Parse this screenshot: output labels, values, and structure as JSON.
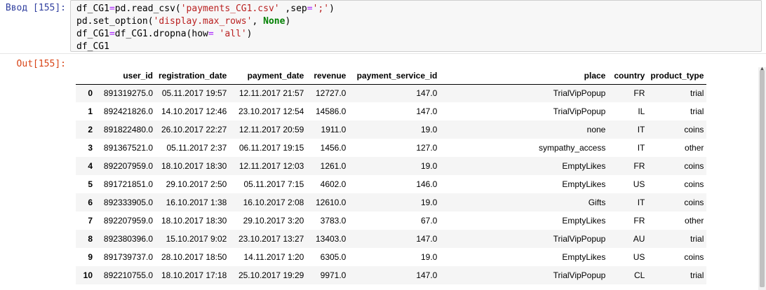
{
  "input": {
    "prompt": "Ввод [155]:",
    "code": [
      [
        {
          "t": "df_CG1",
          "c": ""
        },
        {
          "t": "=",
          "c": "o"
        },
        {
          "t": "pd.read_csv(",
          "c": ""
        },
        {
          "t": "'payments_CG1.csv'",
          "c": "s"
        },
        {
          "t": " ,sep",
          "c": ""
        },
        {
          "t": "=",
          "c": "o"
        },
        {
          "t": "';'",
          "c": "s"
        },
        {
          "t": ")",
          "c": ""
        }
      ],
      [
        {
          "t": "pd.set_option(",
          "c": ""
        },
        {
          "t": "'display.max_rows'",
          "c": "s"
        },
        {
          "t": ", ",
          "c": ""
        },
        {
          "t": "None",
          "c": "k"
        },
        {
          "t": ")",
          "c": ""
        }
      ],
      [
        {
          "t": "df_CG1",
          "c": ""
        },
        {
          "t": "=",
          "c": "o"
        },
        {
          "t": "df_CG1.dropna(how",
          "c": ""
        },
        {
          "t": "=",
          "c": "o"
        },
        {
          "t": " ",
          "c": ""
        },
        {
          "t": "'all'",
          "c": "s"
        },
        {
          "t": ")",
          "c": ""
        }
      ],
      [
        {
          "t": "df_CG1",
          "c": ""
        }
      ]
    ]
  },
  "output": {
    "prompt": "Out[155]:",
    "columns": [
      "",
      "user_id",
      "registration_date",
      "payment_date",
      "revenue",
      "payment_service_id",
      "place",
      "country",
      "product_type"
    ],
    "rows": [
      [
        "0",
        "891319275.0",
        "05.11.2017 19:57",
        "12.11.2017 21:57",
        "12727.0",
        "147.0",
        "TrialVipPopup",
        "FR",
        "trial"
      ],
      [
        "1",
        "892421826.0",
        "14.10.2017 12:46",
        "23.10.2017 12:54",
        "14586.0",
        "147.0",
        "TrialVipPopup",
        "IL",
        "trial"
      ],
      [
        "2",
        "891822480.0",
        "26.10.2017 22:27",
        "12.11.2017 20:59",
        "1911.0",
        "19.0",
        "none",
        "IT",
        "coins"
      ],
      [
        "3",
        "891367521.0",
        "05.11.2017 2:37",
        "06.11.2017 19:15",
        "1456.0",
        "127.0",
        "sympathy_access",
        "IT",
        "other"
      ],
      [
        "4",
        "892207959.0",
        "18.10.2017 18:30",
        "12.11.2017 12:03",
        "1261.0",
        "19.0",
        "EmptyLikes",
        "FR",
        "coins"
      ],
      [
        "5",
        "891721851.0",
        "29.10.2017 2:50",
        "05.11.2017 7:15",
        "4602.0",
        "146.0",
        "EmptyLikes",
        "US",
        "coins"
      ],
      [
        "6",
        "892333905.0",
        "16.10.2017 1:38",
        "16.10.2017 2:08",
        "12610.0",
        "19.0",
        "Gifts",
        "IT",
        "coins"
      ],
      [
        "7",
        "892207959.0",
        "18.10.2017 18:30",
        "29.10.2017 3:20",
        "3783.0",
        "67.0",
        "EmptyLikes",
        "FR",
        "other"
      ],
      [
        "8",
        "892380396.0",
        "15.10.2017 9:02",
        "23.10.2017 13:27",
        "13403.0",
        "147.0",
        "TrialVipPopup",
        "AU",
        "trial"
      ],
      [
        "9",
        "891739737.0",
        "28.10.2017 18:50",
        "14.11.2017 1:20",
        "6305.0",
        "19.0",
        "EmptyLikes",
        "US",
        "coins"
      ],
      [
        "10",
        "892210755.0",
        "18.10.2017 17:18",
        "25.10.2017 19:29",
        "9971.0",
        "147.0",
        "TrialVipPopup",
        "CL",
        "trial"
      ]
    ]
  },
  "colors": {
    "in_prompt": "#303f9f",
    "out_prompt": "#d84315",
    "string": "#ba2121",
    "keyword": "#008000",
    "operator": "#aa22ff"
  }
}
